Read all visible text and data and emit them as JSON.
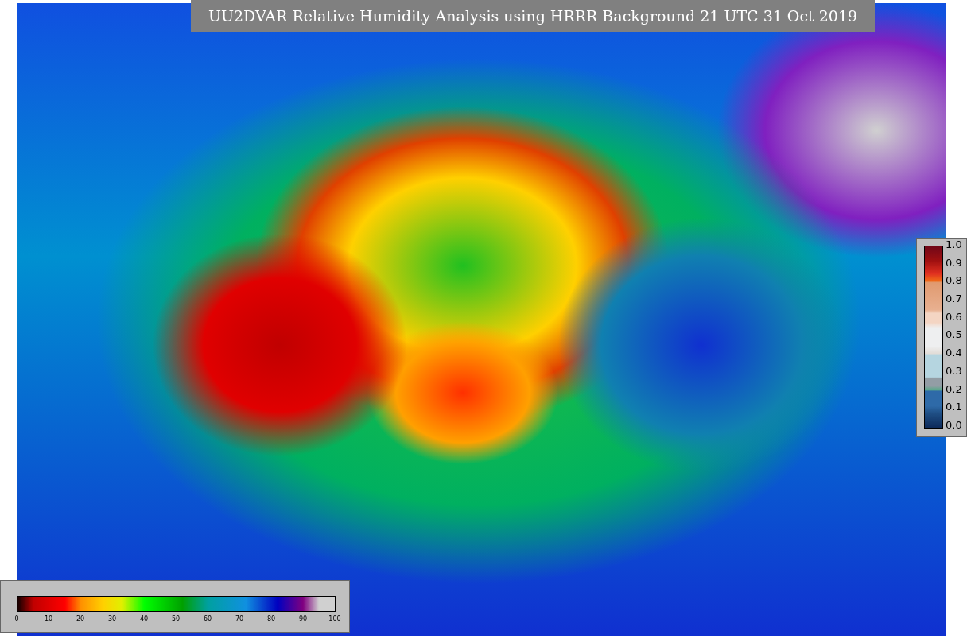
{
  "title": "UU2DVAR Relative Humidity Analysis using HRRR Background 21 UTC 31 Oct 2019",
  "ratio_colorbar": {
    "ticks": [
      "1.0",
      "0.9",
      "0.8",
      "0.7",
      "0.6",
      "0.5",
      "0.4",
      "0.3",
      "0.2",
      "0.1",
      "0.0"
    ]
  },
  "humidity_colorbar": {
    "ticks": [
      "0",
      "10",
      "20",
      "30",
      "40",
      "50",
      "60",
      "70",
      "80",
      "90",
      "100"
    ]
  }
}
